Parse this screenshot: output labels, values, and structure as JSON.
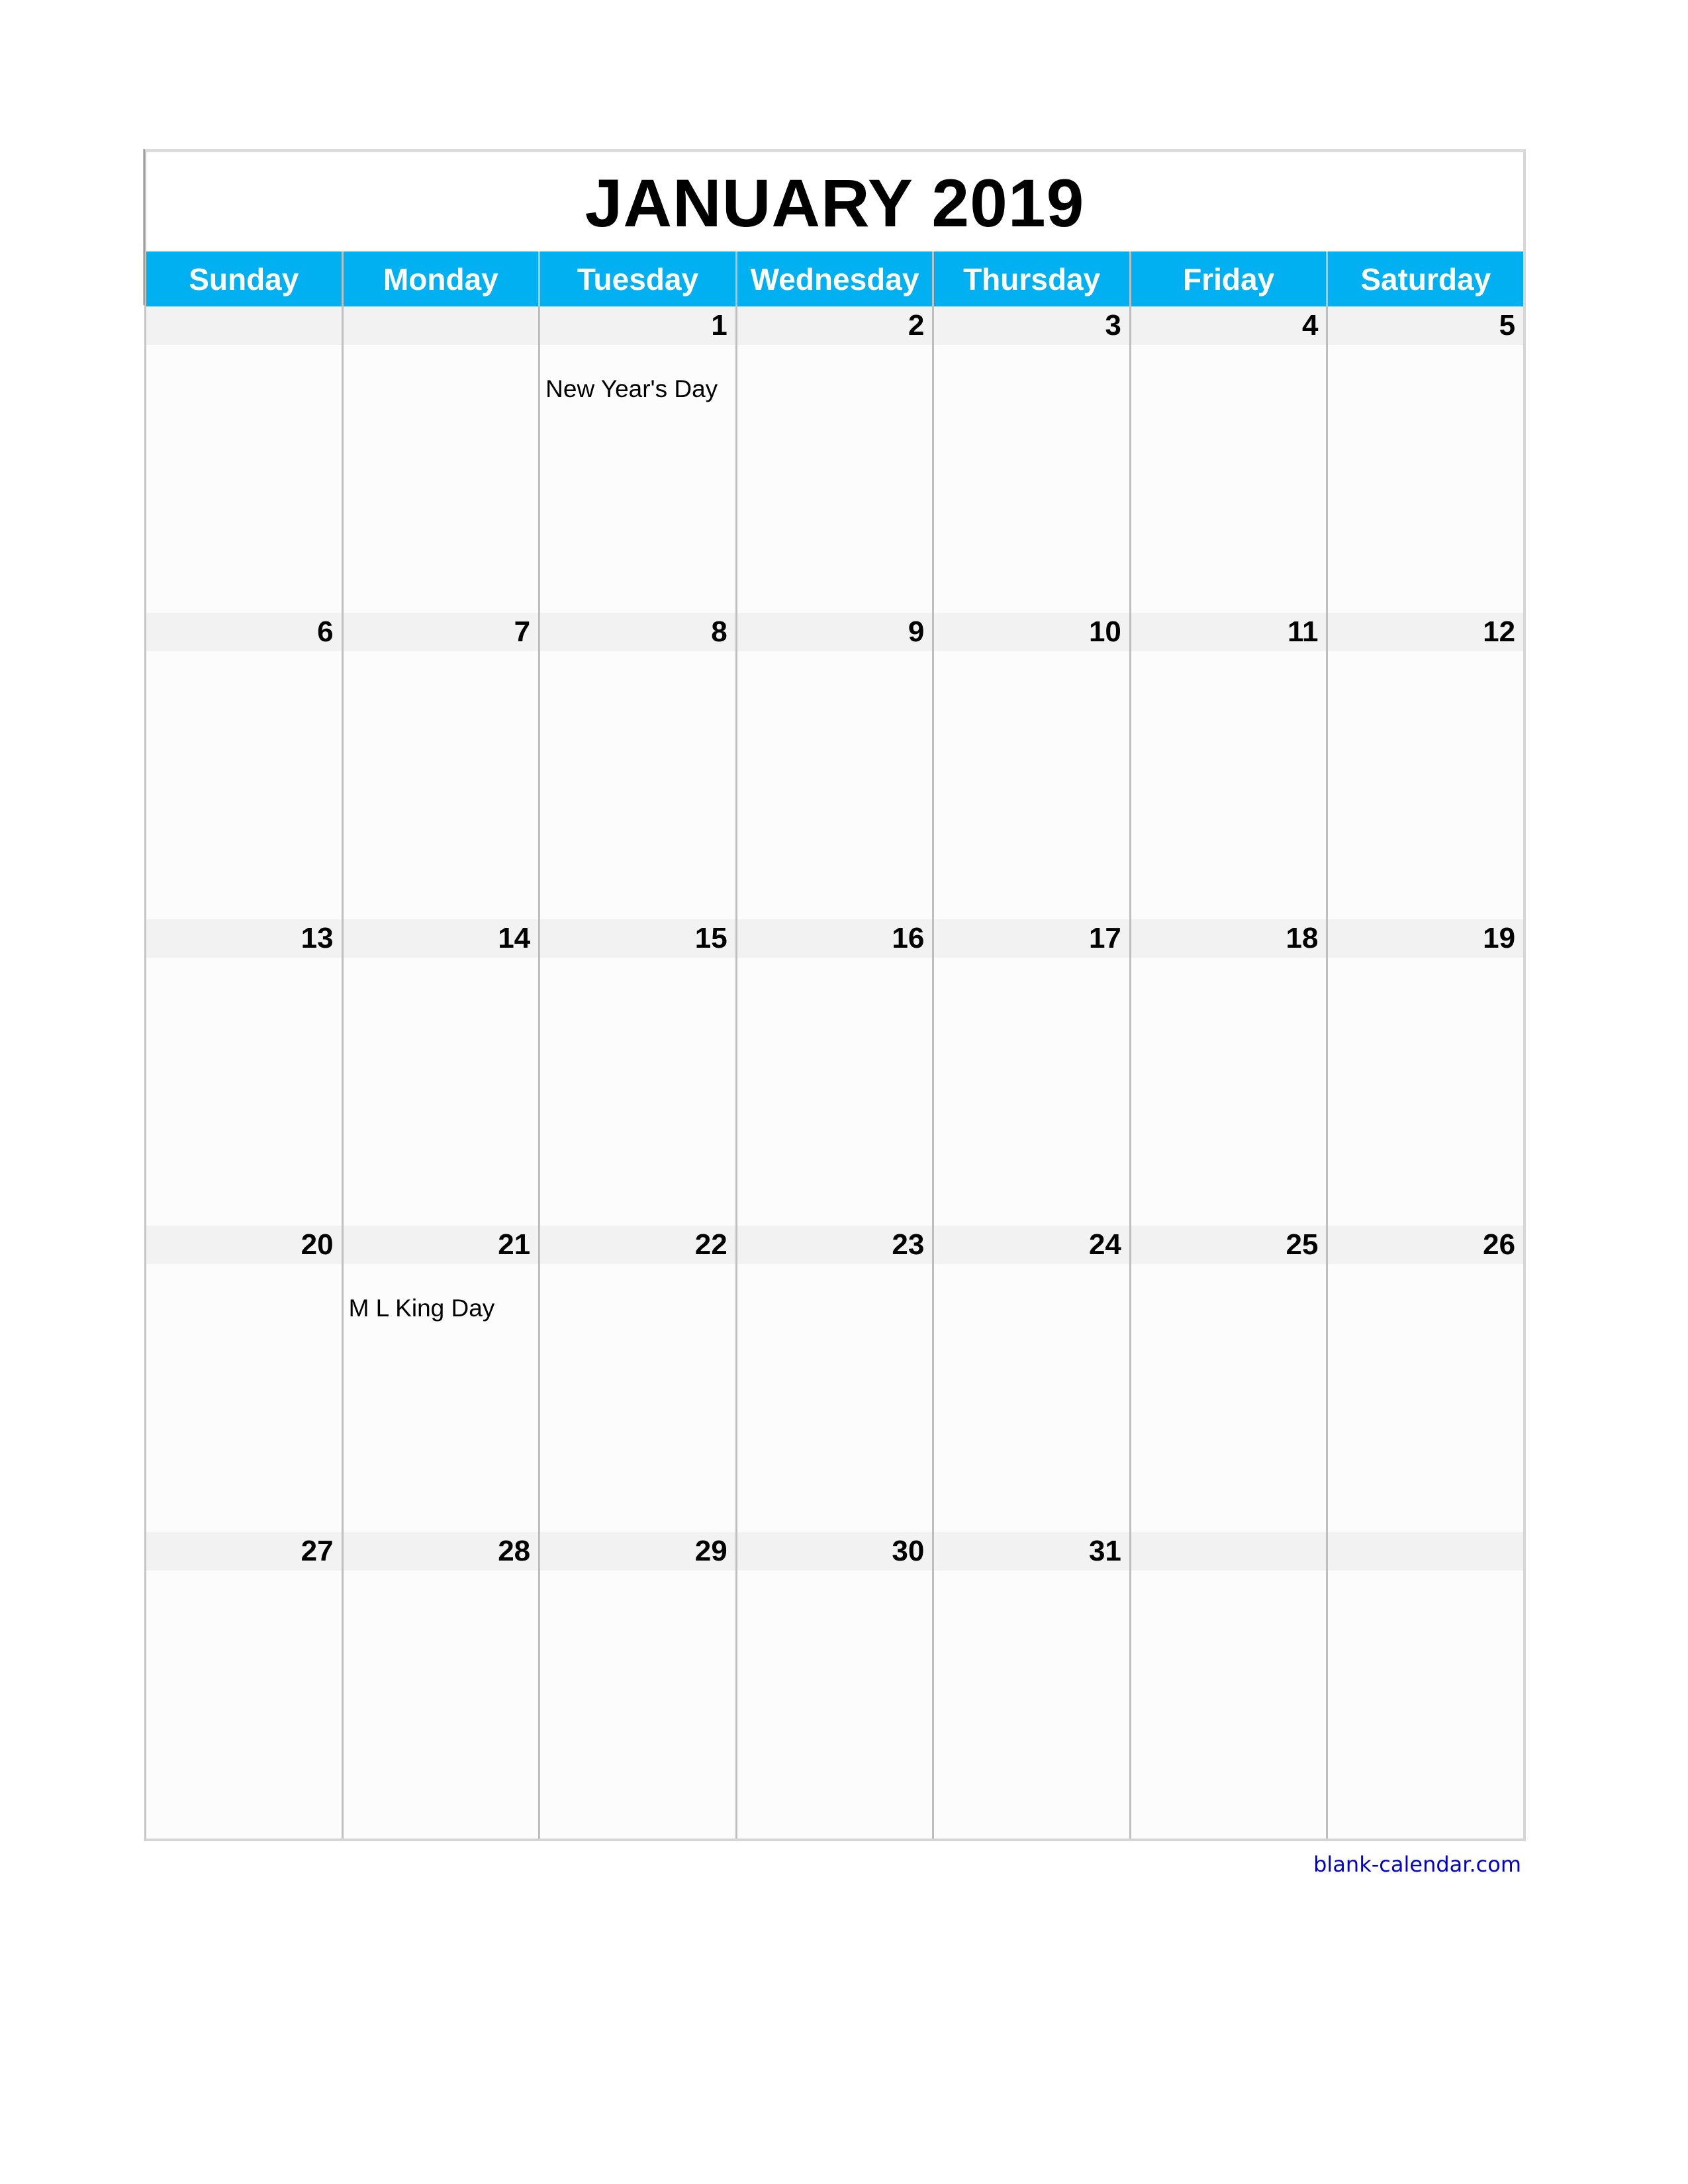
{
  "calendar": {
    "title": "JANUARY 2019",
    "weekdays": [
      "Sunday",
      "Monday",
      "Tuesday",
      "Wednesday",
      "Thursday",
      "Friday",
      "Saturday"
    ],
    "weeks": [
      [
        {
          "date": "",
          "event": ""
        },
        {
          "date": "",
          "event": ""
        },
        {
          "date": "1",
          "event": "New Year's Day"
        },
        {
          "date": "2",
          "event": ""
        },
        {
          "date": "3",
          "event": ""
        },
        {
          "date": "4",
          "event": ""
        },
        {
          "date": "5",
          "event": ""
        }
      ],
      [
        {
          "date": "6",
          "event": ""
        },
        {
          "date": "7",
          "event": ""
        },
        {
          "date": "8",
          "event": ""
        },
        {
          "date": "9",
          "event": ""
        },
        {
          "date": "10",
          "event": ""
        },
        {
          "date": "11",
          "event": ""
        },
        {
          "date": "12",
          "event": ""
        }
      ],
      [
        {
          "date": "13",
          "event": ""
        },
        {
          "date": "14",
          "event": ""
        },
        {
          "date": "15",
          "event": ""
        },
        {
          "date": "16",
          "event": ""
        },
        {
          "date": "17",
          "event": ""
        },
        {
          "date": "18",
          "event": ""
        },
        {
          "date": "19",
          "event": ""
        }
      ],
      [
        {
          "date": "20",
          "event": ""
        },
        {
          "date": "21",
          "event": "M L King Day"
        },
        {
          "date": "22",
          "event": ""
        },
        {
          "date": "23",
          "event": ""
        },
        {
          "date": "24",
          "event": ""
        },
        {
          "date": "25",
          "event": ""
        },
        {
          "date": "26",
          "event": ""
        }
      ],
      [
        {
          "date": "27",
          "event": ""
        },
        {
          "date": "28",
          "event": ""
        },
        {
          "date": "29",
          "event": ""
        },
        {
          "date": "30",
          "event": ""
        },
        {
          "date": "31",
          "event": ""
        },
        {
          "date": "",
          "event": ""
        },
        {
          "date": "",
          "event": ""
        }
      ]
    ]
  },
  "colors": {
    "header_bg": "#00b0f0",
    "date_strip_bg": "#f2f2f2",
    "footer_link": "#0000cc"
  },
  "footer": {
    "link_text": "blank-calendar.com"
  }
}
